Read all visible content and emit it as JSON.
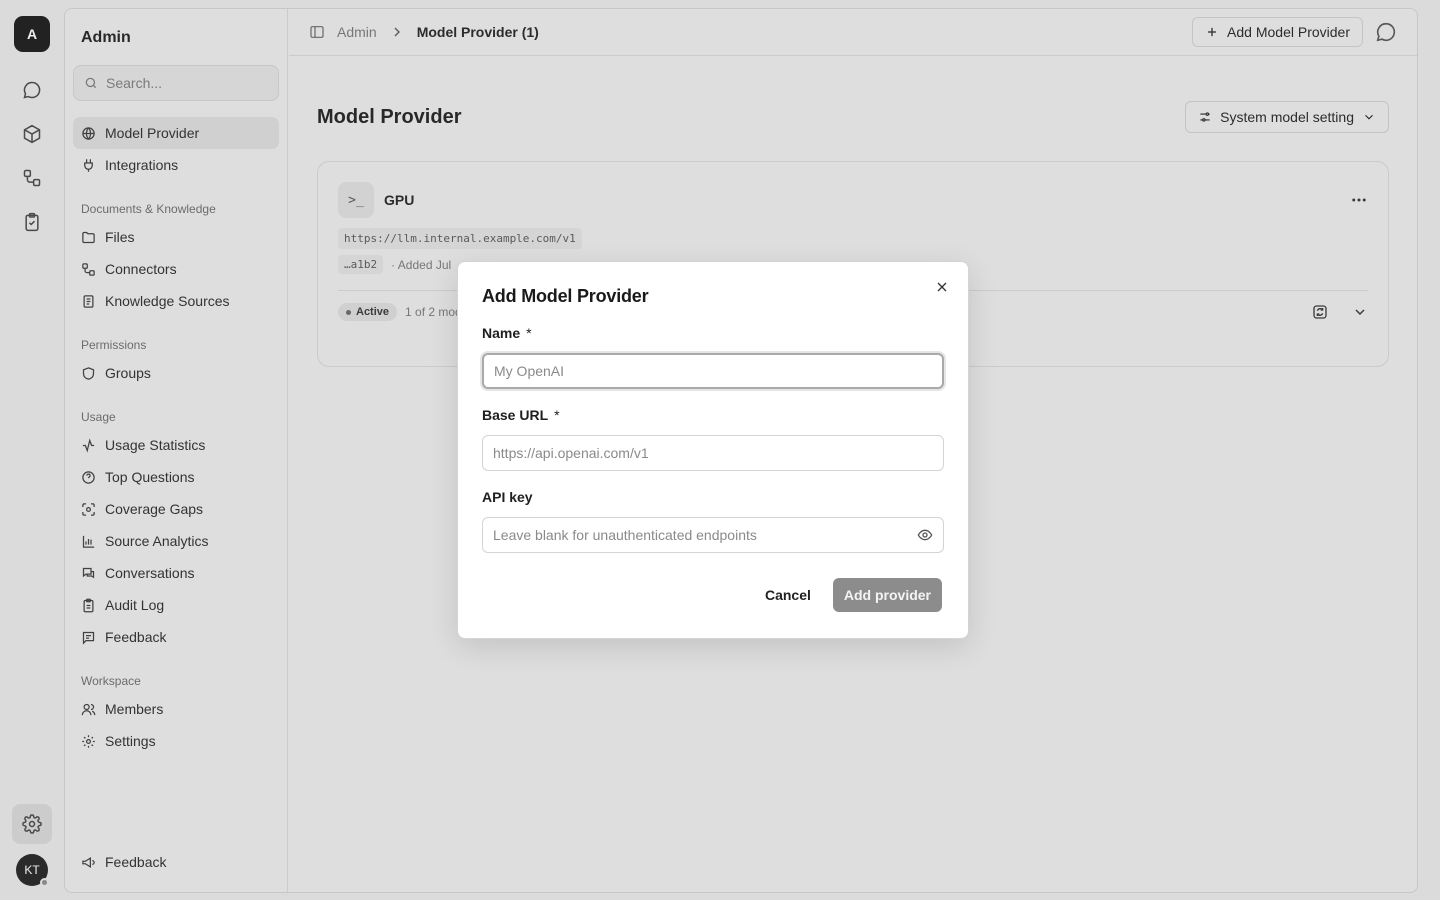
{
  "rail": {
    "logo_letter": "A",
    "avatar_initials": "KT",
    "icons": [
      "chat-icon",
      "cube-icon",
      "workflow-icon",
      "clipboard-check-icon"
    ],
    "settings_icon": "gear-icon"
  },
  "sidebar": {
    "title": "Admin",
    "search_placeholder": "Search...",
    "top_items": [
      {
        "label": "Model Provider",
        "icon": "globe-icon",
        "active": true
      },
      {
        "label": "Integrations",
        "icon": "plug-icon"
      }
    ],
    "sections": [
      {
        "label": "Documents & Knowledge",
        "items": [
          {
            "label": "Files",
            "icon": "folder-icon"
          },
          {
            "label": "Connectors",
            "icon": "connector-icon"
          },
          {
            "label": "Knowledge Sources",
            "icon": "book-icon"
          }
        ]
      },
      {
        "label": "Permissions",
        "items": [
          {
            "label": "Groups",
            "icon": "shield-icon"
          }
        ]
      },
      {
        "label": "Usage",
        "items": [
          {
            "label": "Usage Statistics",
            "icon": "activity-icon"
          },
          {
            "label": "Top Questions",
            "icon": "help-circle-icon"
          },
          {
            "label": "Coverage Gaps",
            "icon": "scan-icon"
          },
          {
            "label": "Source Analytics",
            "icon": "bar-chart-icon"
          },
          {
            "label": "Conversations",
            "icon": "messages-icon"
          },
          {
            "label": "Audit Log",
            "icon": "clipboard-icon"
          },
          {
            "label": "Feedback",
            "icon": "message-square-icon"
          }
        ]
      },
      {
        "label": "Workspace",
        "items": [
          {
            "label": "Members",
            "icon": "users-icon"
          },
          {
            "label": "Settings",
            "icon": "gear-icon"
          }
        ]
      }
    ],
    "footer_item": {
      "label": "Feedback",
      "icon": "megaphone-icon"
    }
  },
  "topbar": {
    "breadcrumb_root": "Admin",
    "breadcrumb_current": "Model Provider (1)",
    "add_button": "Add Model Provider"
  },
  "page": {
    "title": "Model Provider",
    "system_button": "System model setting"
  },
  "provider_card": {
    "icon_text": ">_",
    "name": "GPU",
    "base_url": "https://llm.internal.example.com/v1",
    "key_suffix": "…a1b2",
    "added_text": "· Added Jul",
    "status": "Active",
    "models_text": "1 of 2 mod"
  },
  "modal": {
    "title": "Add Model Provider",
    "name_label": "Name",
    "name_placeholder": "My OpenAI",
    "base_url_label": "Base URL",
    "base_url_placeholder": "https://api.openai.com/v1",
    "api_key_label": "API key",
    "api_key_placeholder": "Leave blank for unauthenticated endpoints",
    "required_mark": "*",
    "cancel": "Cancel",
    "submit": "Add provider"
  }
}
